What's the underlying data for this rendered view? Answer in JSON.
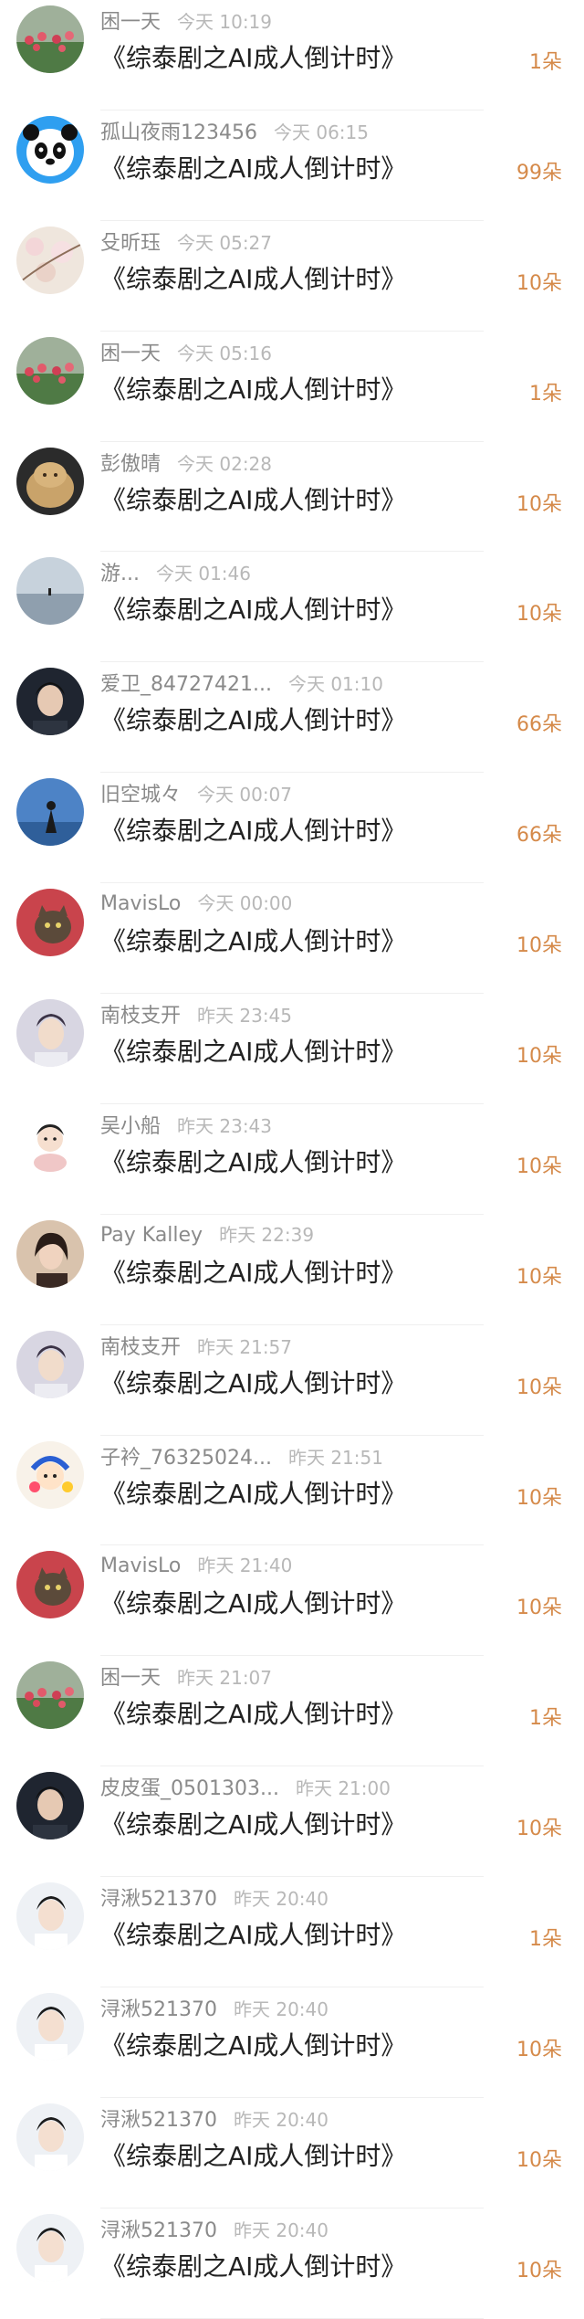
{
  "colors": {
    "username": "#8a8a8a",
    "time": "#b8b8b8",
    "title": "#222222",
    "amount": "#d58a4a",
    "divider": "#efefef"
  },
  "items": [
    {
      "user": "困一天",
      "time": "今天 10:19",
      "title": "《综泰剧之AI成人倒计时》",
      "amount": "1朵",
      "avatar": "flower-field"
    },
    {
      "user": "孤山夜雨123456",
      "time": "今天 06:15",
      "title": "《综泰剧之AI成人倒计时》",
      "amount": "99朵",
      "avatar": "panda"
    },
    {
      "user": "殳昕珏",
      "time": "今天 05:27",
      "title": "《综泰剧之AI成人倒计时》",
      "amount": "10朵",
      "avatar": "blossom"
    },
    {
      "user": "困一天",
      "time": "今天 05:16",
      "title": "《综泰剧之AI成人倒计时》",
      "amount": "1朵",
      "avatar": "flower-field"
    },
    {
      "user": "彭傲晴",
      "time": "今天 02:28",
      "title": "《综泰剧之AI成人倒计时》",
      "amount": "10朵",
      "avatar": "clay-figure"
    },
    {
      "user": "游...",
      "time": "今天 01:46",
      "title": "《综泰剧之AI成人倒计时》",
      "amount": "10朵",
      "avatar": "seaside"
    },
    {
      "user": "爱卫_84727421...",
      "time": "今天 01:10",
      "title": "《综泰剧之AI成人倒计时》",
      "amount": "66朵",
      "avatar": "portrait-dark"
    },
    {
      "user": "旧空城々",
      "time": "今天 00:07",
      "title": "《综泰剧之AI成人倒计时》",
      "amount": "66朵",
      "avatar": "blue-sky"
    },
    {
      "user": "MavisLo",
      "time": "今天 00:00",
      "title": "《综泰剧之AI成人倒计时》",
      "amount": "10朵",
      "avatar": "cat-red"
    },
    {
      "user": "南枝支开",
      "time": "昨天 23:45",
      "title": "《综泰剧之AI成人倒计时》",
      "amount": "10朵",
      "avatar": "portrait-light"
    },
    {
      "user": "吴小船",
      "time": "昨天 23:43",
      "title": "《综泰剧之AI成人倒计时》",
      "amount": "10朵",
      "avatar": "cartoon"
    },
    {
      "user": "Pay Kalley",
      "time": "昨天 22:39",
      "title": "《综泰剧之AI成人倒计时》",
      "amount": "10朵",
      "avatar": "portrait-warm"
    },
    {
      "user": "南枝支开",
      "time": "昨天 21:57",
      "title": "《综泰剧之AI成人倒计时》",
      "amount": "10朵",
      "avatar": "portrait-light"
    },
    {
      "user": "子衿_76325024...",
      "time": "昨天 21:51",
      "title": "《综泰剧之AI成人倒计时》",
      "amount": "10朵",
      "avatar": "cartoon-colorful"
    },
    {
      "user": "MavisLo",
      "time": "昨天 21:40",
      "title": "《综泰剧之AI成人倒计时》",
      "amount": "10朵",
      "avatar": "cat-red"
    },
    {
      "user": "困一天",
      "time": "昨天 21:07",
      "title": "《综泰剧之AI成人倒计时》",
      "amount": "1朵",
      "avatar": "flower-field"
    },
    {
      "user": "皮皮蛋_0501303...",
      "time": "昨天 21:00",
      "title": "《综泰剧之AI成人倒计时》",
      "amount": "10朵",
      "avatar": "portrait-dark"
    },
    {
      "user": "浔湫521370",
      "time": "昨天 20:40",
      "title": "《综泰剧之AI成人倒计时》",
      "amount": "1朵",
      "avatar": "portrait-white"
    },
    {
      "user": "浔湫521370",
      "time": "昨天 20:40",
      "title": "《综泰剧之AI成人倒计时》",
      "amount": "10朵",
      "avatar": "portrait-white"
    },
    {
      "user": "浔湫521370",
      "time": "昨天 20:40",
      "title": "《综泰剧之AI成人倒计时》",
      "amount": "10朵",
      "avatar": "portrait-white"
    },
    {
      "user": "浔湫521370",
      "time": "昨天 20:40",
      "title": "《综泰剧之AI成人倒计时》",
      "amount": "10朵",
      "avatar": "portrait-white"
    }
  ]
}
